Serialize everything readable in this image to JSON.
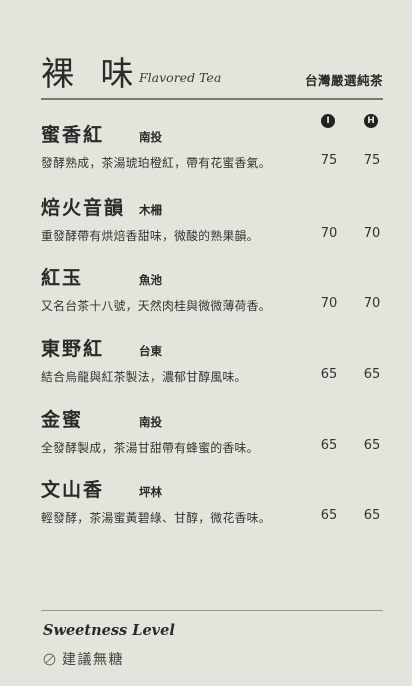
{
  "header": {
    "title_cn": "裸 味",
    "title_en": "Flavored Tea",
    "subtitle": "台灣嚴選純茶"
  },
  "columns": {
    "iced": "I",
    "hot": "H"
  },
  "items": [
    {
      "name": "蜜香紅",
      "origin": "南投",
      "description": "發酵熟成，茶湯琥珀橙紅，帶有花蜜香氣。",
      "price_iced": "75",
      "price_hot": "75"
    },
    {
      "name": "焙火音韻",
      "origin": "木柵",
      "description": "重發酵帶有烘焙香甜味，微酸的熟果韻。",
      "price_iced": "70",
      "price_hot": "70"
    },
    {
      "name": "紅玉",
      "origin": "魚池",
      "description": "又名台茶十八號，天然肉桂與微微薄荷香。",
      "price_iced": "70",
      "price_hot": "70"
    },
    {
      "name": "東野紅",
      "origin": "台東",
      "description": "結合烏龍與紅茶製法，濃郁甘醇風味。",
      "price_iced": "65",
      "price_hot": "65"
    },
    {
      "name": "金蜜",
      "origin": "南投",
      "description": "全發酵製成，茶湯甘甜帶有蜂蜜的香味。",
      "price_iced": "65",
      "price_hot": "65"
    },
    {
      "name": "文山香",
      "origin": "坪林",
      "description": "輕發酵，茶湯蜜黃碧綠、甘醇，微花香味。",
      "price_iced": "65",
      "price_hot": "65"
    }
  ],
  "footer": {
    "sweetness_title": "Sweetness Level",
    "sweetness_note": "建議無糖",
    "sweetness_icon": "no-sugar-icon"
  }
}
